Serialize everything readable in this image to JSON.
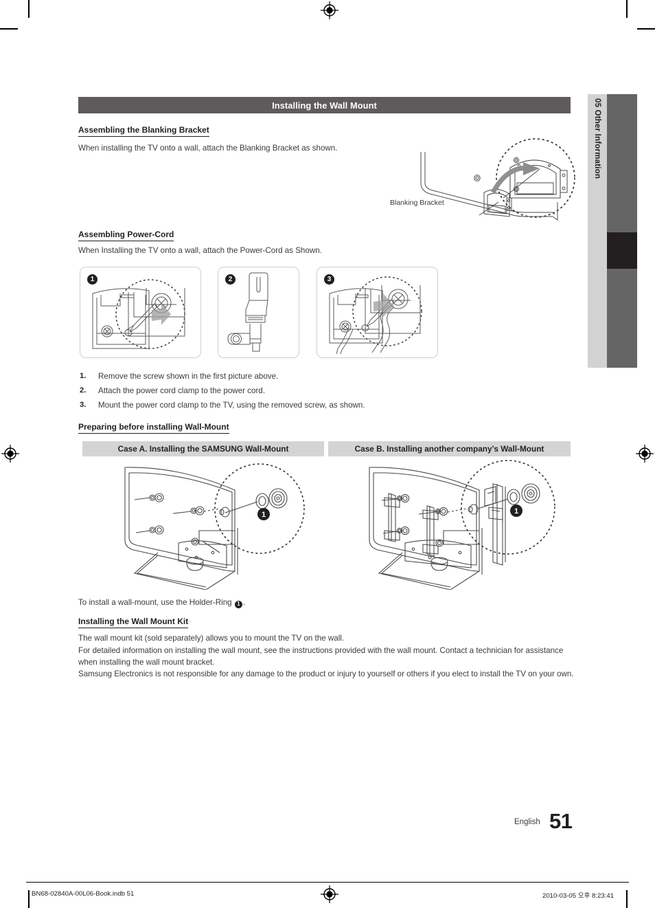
{
  "document": {
    "section_banner": "Installing the Wall Mount",
    "chapter_tab": {
      "number": "05",
      "title": "Other Information",
      "combined": "05  Other Information"
    },
    "page_number": "51",
    "language": "English"
  },
  "blanking_bracket": {
    "heading": "Assembling the Blanking Bracket",
    "body": "When installing the TV onto a wall, attach the Blanking Bracket as shown.",
    "figure_label": "Blanking Bracket"
  },
  "power_cord": {
    "heading": "Assembling Power-Cord",
    "body": "When Installing the TV onto a wall, attach the Power-Cord as Shown.",
    "panels": [
      {
        "badge": "1"
      },
      {
        "badge": "2"
      },
      {
        "badge": "3"
      }
    ],
    "steps": [
      {
        "num": "1.",
        "text": "Remove the screw shown in the first picture above."
      },
      {
        "num": "2.",
        "text": "Attach the power cord clamp to the power cord."
      },
      {
        "num": "3.",
        "text": "Mount the power cord clamp to the TV, using the removed screw, as shown."
      }
    ]
  },
  "preparing": {
    "heading": "Preparing before installing Wall-Mount",
    "case_a": "Case A. Installing the SAMSUNG Wall-Mount",
    "case_b": "Case B. Installing another company’s Wall-Mount",
    "badge_a": "1",
    "badge_b": "1",
    "note_prefix": "To install a wall-mount, use the Holder-Ring ",
    "note_badge": "1",
    "note_suffix": "."
  },
  "wall_mount_kit": {
    "heading": "Installing the Wall Mount Kit",
    "paragraphs": [
      "The wall mount kit (sold separately) allows you to mount the TV on the wall.",
      "For detailed information on installing the wall mount, see the instructions provided with the wall mount. Contact a technician for assistance when installing the wall mount bracket.",
      "Samsung Electronics is not responsible for any damage to the product or injury to yourself or others if you elect to install the TV on your own."
    ]
  },
  "print_footer": {
    "file": "BN68-02840A-00L06-Book.indb   51",
    "timestamp": "2010-03-05   오후 8:23:41"
  },
  "colors": {
    "banner_bg": "#5f5b5c",
    "case_bg": "#d4d4d4",
    "tab_strip_bg": "#d2d2d2",
    "tab_bar_bg": "#656565",
    "tab_active_bg": "#231f20",
    "text": "#231f20"
  }
}
